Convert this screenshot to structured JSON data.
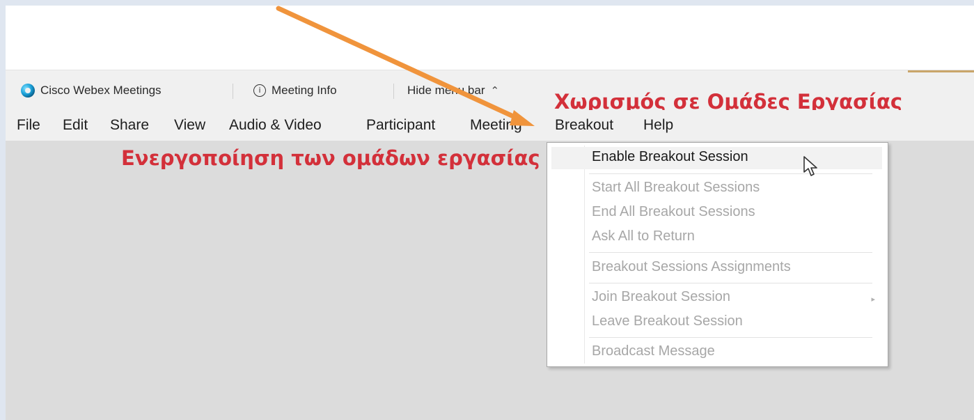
{
  "titlebar": {
    "app_name": "Cisco Webex Meetings",
    "meeting_info": "Meeting Info",
    "hide_menu_bar": "Hide menu bar",
    "chevron_icon": "chevron-up-icon"
  },
  "annotations": {
    "top": "Χωρισμός σε Ομάδες Εργασίας",
    "left": "Ενεργοποίηση των ομάδων εργασίας"
  },
  "menubar": {
    "items": [
      {
        "label": "File"
      },
      {
        "label": "Edit"
      },
      {
        "label": "Share"
      },
      {
        "label": "View"
      },
      {
        "label": "Audio & Video"
      },
      {
        "label": "Participant"
      },
      {
        "label": "Meeting"
      },
      {
        "label": "Breakout"
      },
      {
        "label": "Help"
      }
    ],
    "active": "Breakout"
  },
  "breakout_menu": {
    "items": [
      {
        "label": "Enable Breakout Session",
        "enabled": true
      },
      {
        "label": "Start All Breakout Sessions",
        "enabled": false
      },
      {
        "label": "End All Breakout Sessions",
        "enabled": false
      },
      {
        "label": "Ask All to Return",
        "enabled": false
      },
      {
        "label": "Breakout Sessions Assignments",
        "enabled": false
      },
      {
        "label": "Join Breakout Session",
        "enabled": false,
        "submenu_indicator": "▸"
      },
      {
        "label": "Leave Breakout Session",
        "enabled": false
      },
      {
        "label": "Broadcast Message",
        "enabled": false
      }
    ]
  },
  "colors": {
    "annotation_red": "#d3303a",
    "arrow_orange": "#f0943c"
  }
}
